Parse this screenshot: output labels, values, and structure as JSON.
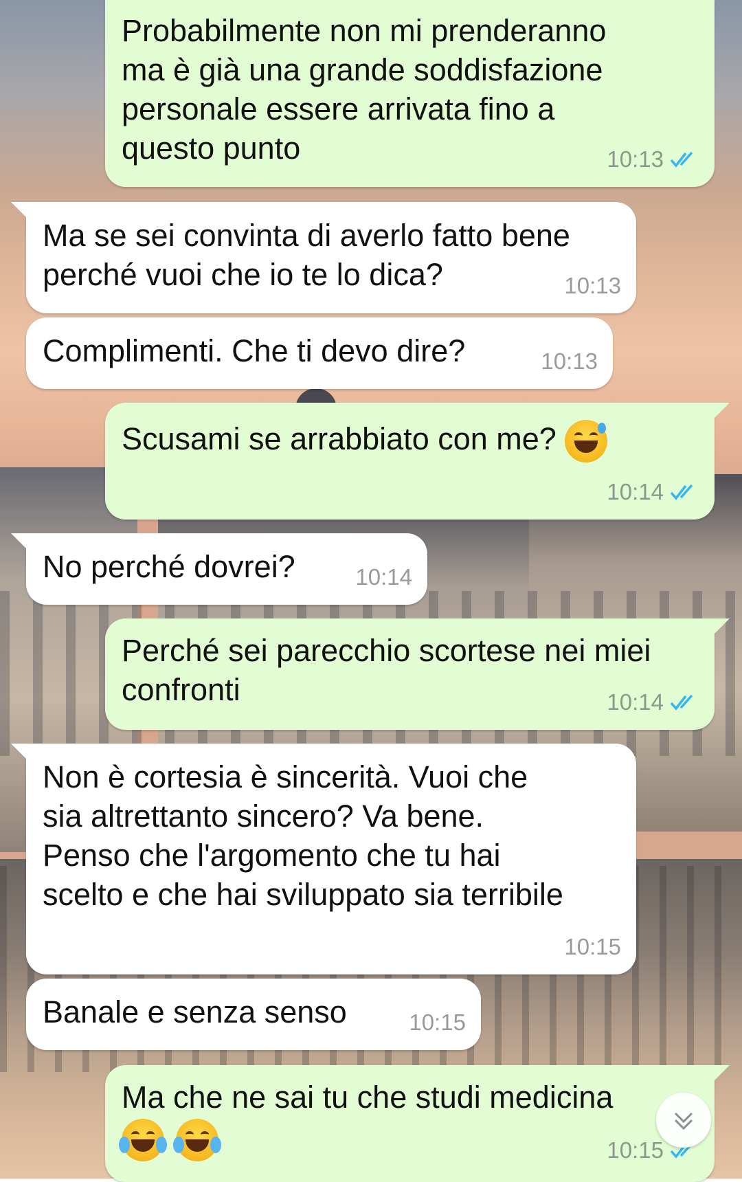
{
  "messages": [
    {
      "dir": "out",
      "text": "Probabilmente non mi prenderanno\nma è già una grande soddisfazione\npersonale essere arrivata fino a\nquesto punto",
      "time": "10:13",
      "status": "read"
    },
    {
      "dir": "in",
      "text": "Ma se sei convinta di averlo fatto bene\nperché vuoi che io te lo dica?",
      "time": "10:13"
    },
    {
      "dir": "in",
      "text": "Complimenti. Che ti devo dire?",
      "time": "10:13"
    },
    {
      "dir": "out",
      "text": "Scusami se arrabbiato con me?",
      "emoji": [
        "sweat-smile"
      ],
      "time": "10:14",
      "status": "read"
    },
    {
      "dir": "in",
      "text": "No perché dovrei?",
      "time": "10:14"
    },
    {
      "dir": "out",
      "text": "Perché sei parecchio scortese nei miei\nconfronti",
      "time": "10:14",
      "status": "read"
    },
    {
      "dir": "in",
      "text": "Non è cortesia è sincerità. Vuoi che\nsia altrettanto sincero? Va bene.\nPenso che l'argomento che tu hai\nscelto e che hai sviluppato sia terribile",
      "time": "10:15"
    },
    {
      "dir": "in",
      "text": "Banale e senza senso",
      "time": "10:15"
    },
    {
      "dir": "out",
      "text": "Ma che ne sai tu che studi medicina",
      "emoji": [
        "joy",
        "joy"
      ],
      "time": "10:15",
      "status": "read"
    }
  ],
  "colors": {
    "outgoing_bubble": "#e2fcd3",
    "incoming_bubble": "#ffffff",
    "read_ticks": "#34b7f1"
  },
  "icons": {
    "read_receipt": "double-check-icon",
    "scroll_down": "chevron-double-down-icon"
  }
}
